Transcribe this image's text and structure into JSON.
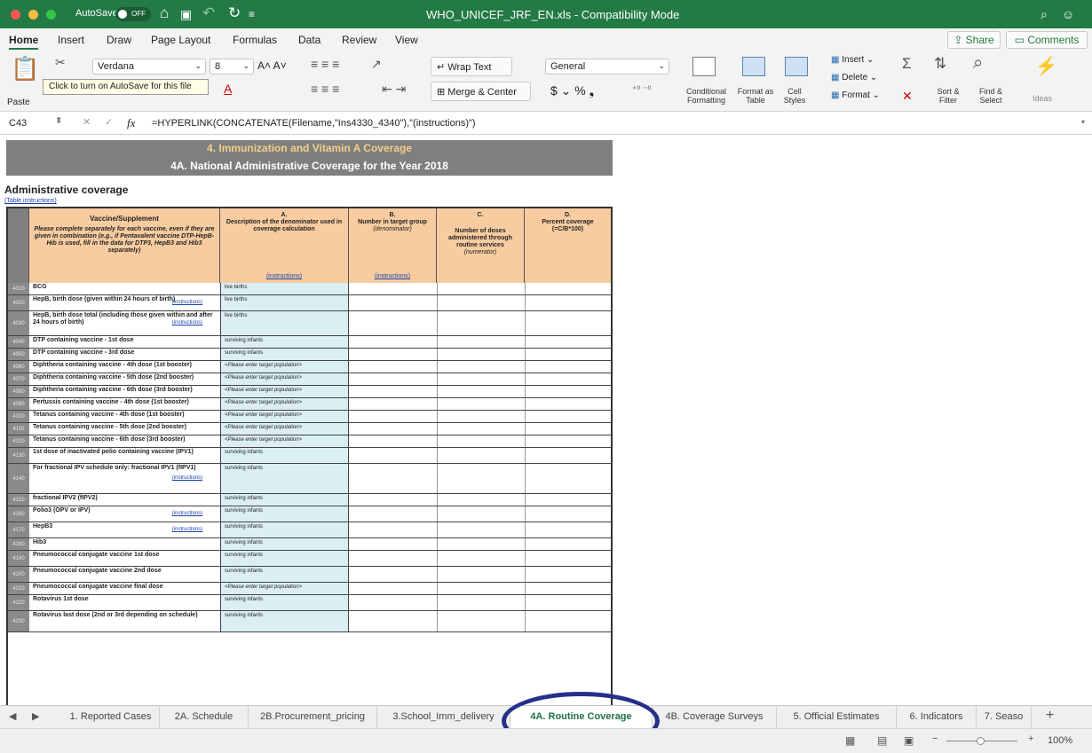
{
  "titlebar": {
    "autosave": "AutoSave",
    "toggle": "OFF",
    "title": "WHO_UNICEF_JRF_EN.xls  -  Compatibility Mode"
  },
  "ribbon_tabs": [
    "Home",
    "Insert",
    "Draw",
    "Page Layout",
    "Formulas",
    "Data",
    "Review",
    "View"
  ],
  "share": "Share",
  "comments": "Comments",
  "ribbon": {
    "paste": "Paste",
    "font": "Verdana",
    "size": "8",
    "wrap": "Wrap Text",
    "merge": "Merge & Center",
    "number_format": "General",
    "cond_fmt": "Conditional Formatting",
    "fmt_table": "Format as Table",
    "cell_styles": "Cell Styles",
    "insert": "Insert",
    "delete": "Delete",
    "format": "Format",
    "sort": "Sort & Filter",
    "find": "Find & Select",
    "ideas": "Ideas"
  },
  "tooltip": "Click to turn on AutoSave for this file",
  "formula": {
    "cell": "C43",
    "fx": "fx",
    "value": "=HYPERLINK(CONCATENATE(Filename,\"Ins4330_4340\"),\"(instructions)\")"
  },
  "sheet": {
    "header1": "4. Immunization and Vitamin A Coverage",
    "header2": "4A. National Administrative Coverage for the Year 2018",
    "section": "Administrative coverage",
    "table_instructions": "(Table instructions)",
    "col_vaccine": "Vaccine/Supplement",
    "col_vaccine_note": "Please complete separately for each vaccine, even if they are given in combination (e.g., if Pentavalent vaccine DTP-HepB-Hib is used, fill in the data for DTP3, HepB3 and Hib3 separately)",
    "col_a_letter": "A.",
    "col_a": "Description of the denominator used in coverage calculation",
    "col_a_inst": "(instructions)",
    "col_b_letter": "B.",
    "col_b": "Number in target group",
    "col_b_sub": "(denominator)",
    "col_b_inst": "(instructions)",
    "col_c_letter": "C.",
    "col_c": "Number of doses administered through routine services",
    "col_c_sub": "(numerator)",
    "col_d_letter": "D.",
    "col_d": "Percent coverage (=C/B*100)",
    "rows": [
      {
        "num": "4010",
        "label": "BCG",
        "inst": "",
        "desc": "live births"
      },
      {
        "num": "4020",
        "label": "HepB, birth dose (given within 24 hours of birth)",
        "inst": "(instructions)",
        "desc": "live births"
      },
      {
        "num": "4030",
        "label": "HepB, birth dose total (including those given within and after 24 hours of birth)",
        "inst": "(instructions)",
        "desc": "live births"
      },
      {
        "num": "4040",
        "label": "DTP containing vaccine - 1st dose",
        "inst": "",
        "desc": "surviving infants"
      },
      {
        "num": "4050",
        "label": "DTP containing vaccine - 3rd dose",
        "inst": "",
        "desc": "surviving infants"
      },
      {
        "num": "4060",
        "label": "Diphtheria containing vaccine - 4th dose (1st booster)",
        "inst": "",
        "desc": "<Please enter target population>"
      },
      {
        "num": "4070",
        "label": "Diphtheria containing vaccine - 5th dose (2nd booster)",
        "inst": "",
        "desc": "<Please enter target population>"
      },
      {
        "num": "4080",
        "label": "Diphtheria containing vaccine - 6th dose (3rd booster)",
        "inst": "",
        "desc": "<Please enter target population>"
      },
      {
        "num": "4090",
        "label": "Pertussis containing vaccine - 4th dose (1st booster)",
        "inst": "",
        "desc": "<Please enter target population>"
      },
      {
        "num": "4100",
        "label": "Tetanus containing vaccine - 4th dose (1st booster)",
        "inst": "",
        "desc": "<Please enter target population>"
      },
      {
        "num": "4110",
        "label": "Tetanus containing vaccine - 5th dose (2nd booster)",
        "inst": "",
        "desc": "<Please enter target population>"
      },
      {
        "num": "4120",
        "label": "Tetanus containing vaccine - 6th dose (3rd booster)",
        "inst": "",
        "desc": "<Please enter target population>"
      },
      {
        "num": "4130",
        "label": "1st dose of inactivated polio containing vaccine (IPV1)",
        "inst": "",
        "desc": "surviving infants"
      },
      {
        "num": "4140",
        "label": "For fractional IPV schedule only: fractional IPV1 (fIPV1)",
        "inst": "(instructions)",
        "desc": "surviving infants"
      },
      {
        "num": "4150",
        "label": "fractional IPV2 (fIPV2)",
        "inst": "",
        "desc": "surviving infants"
      },
      {
        "num": "4160",
        "label": "Polio3 (OPV or IPV)",
        "inst": "(instructions)",
        "desc": "surviving infants"
      },
      {
        "num": "4170",
        "label": "HepB3",
        "inst": "(instructions)",
        "desc": "surviving infants"
      },
      {
        "num": "4180",
        "label": "Hib3",
        "inst": "",
        "desc": "surviving infants"
      },
      {
        "num": "4190",
        "label": "Pneumococcal conjugate vaccine 1st dose",
        "inst": "",
        "desc": "surviving infants"
      },
      {
        "num": "4200",
        "label": "Pneumococcal conjugate vaccine 2nd dose",
        "inst": "",
        "desc": "surviving infants"
      },
      {
        "num": "4210",
        "label": "Pneumococcal conjugate vaccine final dose",
        "inst": "",
        "desc": "<Please enter target population>"
      },
      {
        "num": "4220",
        "label": "Rotavirus 1st dose",
        "inst": "",
        "desc": "surviving infants"
      },
      {
        "num": "4230",
        "label": "Rotavirus last dose (2nd or 3rd depending on schedule)",
        "inst": "",
        "desc": "surviving infants"
      }
    ]
  },
  "sheet_tabs": [
    "1. Reported Cases",
    "2A. Schedule",
    "2B.Procurement_pricing",
    "3.School_Imm_delivery",
    "4A. Routine Coverage",
    "4B. Coverage Surveys",
    "5. Official Estimates",
    "6. Indicators",
    "7. Seaso"
  ],
  "zoom": "100%",
  "colors": {
    "excel_green": "#237a45",
    "header_gray": "#7f7f7f",
    "orange": "#f8cca0",
    "light_blue": "#daeef3",
    "circle": "#25308a"
  }
}
